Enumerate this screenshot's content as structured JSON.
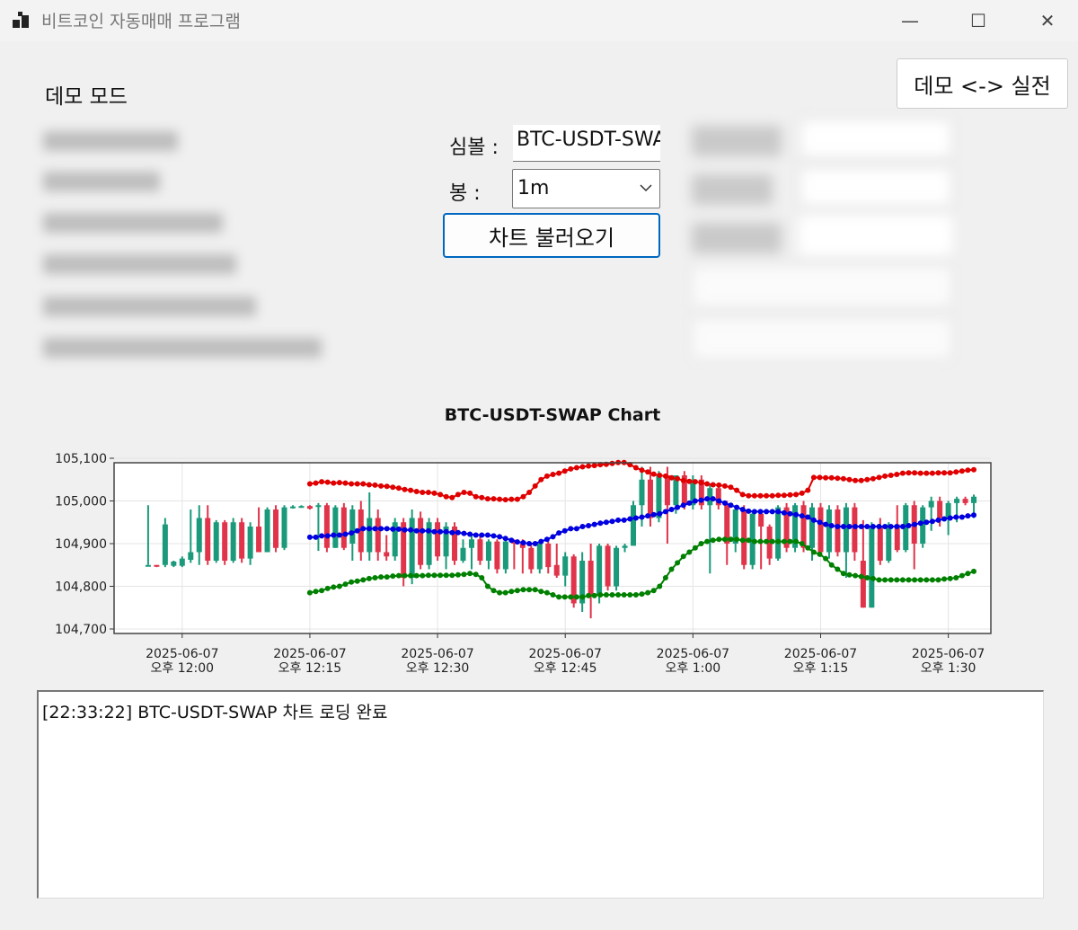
{
  "window": {
    "title": "비트코인 자동매매 프로그램",
    "minimize_glyph": "—",
    "maximize_glyph": "☐",
    "close_glyph": "✕"
  },
  "mode": {
    "label": "데모 모드",
    "toggle_label": "데모 <-> 실전"
  },
  "form": {
    "symbol_label": "심볼 :",
    "symbol_value": "BTC-USDT-SWAP",
    "interval_label": "봉 :",
    "interval_value": "1m",
    "load_button": "차트 불러오기"
  },
  "chart_data": {
    "type": "candlestick",
    "title": "BTC-USDT-SWAP Chart",
    "ylim": [
      104700,
      105100
    ],
    "y_ticks": [
      "105,100",
      "105,000",
      "104,900",
      "104,800",
      "104,700"
    ],
    "x_ticks": [
      {
        "date": "2025-06-07",
        "time": "오후 12:00"
      },
      {
        "date": "2025-06-07",
        "time": "오후 12:15"
      },
      {
        "date": "2025-06-07",
        "time": "오후 12:30"
      },
      {
        "date": "2025-06-07",
        "time": "오후 12:45"
      },
      {
        "date": "2025-06-07",
        "time": "오후 1:00"
      },
      {
        "date": "2025-06-07",
        "time": "오후 1:15"
      },
      {
        "date": "2025-06-07",
        "time": "오후 1:30"
      }
    ],
    "x_start": "2025-06-07 11:52",
    "x_end": "2025-06-07 13:35",
    "candle_times": [
      "11:56",
      "11:57",
      "11:58",
      "11:59",
      "12:00",
      "12:01",
      "12:02",
      "12:03",
      "12:04",
      "12:05",
      "12:06",
      "12:07",
      "12:08",
      "12:09",
      "12:10",
      "12:11",
      "12:12",
      "12:13",
      "12:14",
      "12:15",
      "12:16",
      "12:17",
      "12:18",
      "12:19",
      "12:20",
      "12:21",
      "12:22",
      "12:23",
      "12:24",
      "12:25",
      "12:26",
      "12:27",
      "12:28",
      "12:29",
      "12:30",
      "12:31",
      "12:32",
      "12:33",
      "12:34",
      "12:35",
      "12:36",
      "12:37",
      "12:38",
      "12:39",
      "12:40",
      "12:41",
      "12:42",
      "12:43",
      "12:44",
      "12:45",
      "12:46",
      "12:47",
      "12:48",
      "12:49",
      "12:50",
      "12:51",
      "12:52",
      "12:53",
      "12:54",
      "12:55",
      "12:56",
      "12:57",
      "12:58",
      "12:59",
      "13:00",
      "13:01",
      "13:02",
      "13:03",
      "13:04",
      "13:05",
      "13:06",
      "13:07",
      "13:08",
      "13:09",
      "13:10",
      "13:11",
      "13:12",
      "13:13",
      "13:14",
      "13:15",
      "13:16",
      "13:17",
      "13:18",
      "13:19",
      "13:20",
      "13:21",
      "13:22",
      "13:23",
      "13:24",
      "13:25",
      "13:26",
      "13:27",
      "13:28",
      "13:29",
      "13:30",
      "13:31",
      "13:32",
      "13:33"
    ],
    "candles": [
      {
        "o": 104850,
        "h": 104990,
        "l": 104850,
        "c": 104850
      },
      {
        "o": 104850,
        "h": 104850,
        "l": 104845,
        "c": 104848
      },
      {
        "o": 104850,
        "h": 104960,
        "l": 104845,
        "c": 104945
      },
      {
        "o": 104848,
        "h": 104860,
        "l": 104845,
        "c": 104858
      },
      {
        "o": 104848,
        "h": 104870,
        "l": 104845,
        "c": 104865
      },
      {
        "o": 104862,
        "h": 104980,
        "l": 104855,
        "c": 104880
      },
      {
        "o": 104880,
        "h": 104990,
        "l": 104850,
        "c": 104960
      },
      {
        "o": 104960,
        "h": 104990,
        "l": 104850,
        "c": 104860
      },
      {
        "o": 104860,
        "h": 104955,
        "l": 104855,
        "c": 104950
      },
      {
        "o": 104950,
        "h": 104955,
        "l": 104850,
        "c": 104860
      },
      {
        "o": 104860,
        "h": 104960,
        "l": 104855,
        "c": 104950
      },
      {
        "o": 104950,
        "h": 104960,
        "l": 104855,
        "c": 104865
      },
      {
        "o": 104865,
        "h": 104950,
        "l": 104850,
        "c": 104940
      },
      {
        "o": 104940,
        "h": 104985,
        "l": 104880,
        "c": 104880
      },
      {
        "o": 104880,
        "h": 104985,
        "l": 104880,
        "c": 104980
      },
      {
        "o": 104980,
        "h": 104990,
        "l": 104880,
        "c": 104890
      },
      {
        "o": 104890,
        "h": 104990,
        "l": 104885,
        "c": 104985
      },
      {
        "o": 104985,
        "h": 104990,
        "l": 104982,
        "c": 104987
      },
      {
        "o": 104987,
        "h": 104990,
        "l": 104984,
        "c": 104988
      },
      {
        "o": 104988,
        "h": 104990,
        "l": 104980,
        "c": 104982
      },
      {
        "o": 104990,
        "h": 104995,
        "l": 104883,
        "c": 104990
      },
      {
        "o": 104990,
        "h": 104995,
        "l": 104880,
        "c": 104890
      },
      {
        "o": 104890,
        "h": 104990,
        "l": 104890,
        "c": 104985
      },
      {
        "o": 104985,
        "h": 104995,
        "l": 104885,
        "c": 104890
      },
      {
        "o": 104900,
        "h": 104990,
        "l": 104860,
        "c": 104980
      },
      {
        "o": 104980,
        "h": 105000,
        "l": 104860,
        "c": 104880
      },
      {
        "o": 104880,
        "h": 105020,
        "l": 104860,
        "c": 104960
      },
      {
        "o": 104960,
        "h": 104980,
        "l": 104860,
        "c": 104880
      },
      {
        "o": 104880,
        "h": 104920,
        "l": 104860,
        "c": 104870
      },
      {
        "o": 104870,
        "h": 104960,
        "l": 104860,
        "c": 104950
      },
      {
        "o": 104950,
        "h": 104960,
        "l": 104800,
        "c": 104820
      },
      {
        "o": 104820,
        "h": 104980,
        "l": 104805,
        "c": 104960
      },
      {
        "o": 104960,
        "h": 104975,
        "l": 104840,
        "c": 104850
      },
      {
        "o": 104850,
        "h": 104960,
        "l": 104840,
        "c": 104950
      },
      {
        "o": 104950,
        "h": 104960,
        "l": 104860,
        "c": 104870
      },
      {
        "o": 104870,
        "h": 104950,
        "l": 104840,
        "c": 104940
      },
      {
        "o": 104940,
        "h": 104950,
        "l": 104850,
        "c": 104860
      },
      {
        "o": 104860,
        "h": 104910,
        "l": 104855,
        "c": 104890
      },
      {
        "o": 104890,
        "h": 104920,
        "l": 104840,
        "c": 104910
      },
      {
        "o": 104910,
        "h": 104920,
        "l": 104850,
        "c": 104860
      },
      {
        "o": 104860,
        "h": 104910,
        "l": 104840,
        "c": 104905
      },
      {
        "o": 104905,
        "h": 104910,
        "l": 104830,
        "c": 104840
      },
      {
        "o": 104840,
        "h": 104910,
        "l": 104830,
        "c": 104905
      },
      {
        "o": 104905,
        "h": 104910,
        "l": 104840,
        "c": 104900
      },
      {
        "o": 104900,
        "h": 104910,
        "l": 104830,
        "c": 104890
      },
      {
        "o": 104890,
        "h": 104900,
        "l": 104830,
        "c": 104840
      },
      {
        "o": 104840,
        "h": 104905,
        "l": 104830,
        "c": 104900
      },
      {
        "o": 104900,
        "h": 104905,
        "l": 104830,
        "c": 104845
      },
      {
        "o": 104850,
        "h": 104900,
        "l": 104820,
        "c": 104825
      },
      {
        "o": 104825,
        "h": 104880,
        "l": 104800,
        "c": 104870
      },
      {
        "o": 104870,
        "h": 104875,
        "l": 104750,
        "c": 104760
      },
      {
        "o": 104760,
        "h": 104880,
        "l": 104740,
        "c": 104860
      },
      {
        "o": 104860,
        "h": 104900,
        "l": 104725,
        "c": 104780
      },
      {
        "o": 104780,
        "h": 104900,
        "l": 104760,
        "c": 104895
      },
      {
        "o": 104895,
        "h": 104900,
        "l": 104790,
        "c": 104800
      },
      {
        "o": 104800,
        "h": 104895,
        "l": 104790,
        "c": 104890
      },
      {
        "o": 104890,
        "h": 104900,
        "l": 104880,
        "c": 104895
      },
      {
        "o": 104895,
        "h": 105000,
        "l": 104895,
        "c": 104990
      },
      {
        "o": 104990,
        "h": 105080,
        "l": 104940,
        "c": 105050
      },
      {
        "o": 105050,
        "h": 105080,
        "l": 104940,
        "c": 104960
      },
      {
        "o": 104960,
        "h": 105070,
        "l": 104950,
        "c": 105060
      },
      {
        "o": 105060,
        "h": 105080,
        "l": 104900,
        "c": 104990
      },
      {
        "o": 104990,
        "h": 105060,
        "l": 104970,
        "c": 105060
      },
      {
        "o": 105060,
        "h": 105070,
        "l": 104980,
        "c": 104990
      },
      {
        "o": 104990,
        "h": 105060,
        "l": 104980,
        "c": 105050
      },
      {
        "o": 105050,
        "h": 105060,
        "l": 104980,
        "c": 104990
      },
      {
        "o": 104990,
        "h": 105040,
        "l": 104830,
        "c": 105030
      },
      {
        "o": 105030,
        "h": 105040,
        "l": 104980,
        "c": 104990
      },
      {
        "o": 104990,
        "h": 105000,
        "l": 104850,
        "c": 104900
      },
      {
        "o": 104900,
        "h": 104990,
        "l": 104880,
        "c": 104980
      },
      {
        "o": 104980,
        "h": 104990,
        "l": 104840,
        "c": 104850
      },
      {
        "o": 104850,
        "h": 104975,
        "l": 104840,
        "c": 104970
      },
      {
        "o": 104970,
        "h": 104975,
        "l": 104840,
        "c": 104940
      },
      {
        "o": 104940,
        "h": 104945,
        "l": 104850,
        "c": 104865
      },
      {
        "o": 104865,
        "h": 104990,
        "l": 104860,
        "c": 104985
      },
      {
        "o": 104985,
        "h": 104995,
        "l": 104880,
        "c": 104890
      },
      {
        "o": 104890,
        "h": 104995,
        "l": 104880,
        "c": 104990
      },
      {
        "o": 104990,
        "h": 105000,
        "l": 104880,
        "c": 104890
      },
      {
        "o": 104890,
        "h": 104995,
        "l": 104860,
        "c": 104985
      },
      {
        "o": 104985,
        "h": 104995,
        "l": 104870,
        "c": 104880
      },
      {
        "o": 104880,
        "h": 104990,
        "l": 104865,
        "c": 104980
      },
      {
        "o": 104980,
        "h": 104990,
        "l": 104870,
        "c": 104880
      },
      {
        "o": 104880,
        "h": 104995,
        "l": 104820,
        "c": 104985
      },
      {
        "o": 104985,
        "h": 104995,
        "l": 104860,
        "c": 104880
      },
      {
        "o": 104860,
        "h": 104955,
        "l": 104750,
        "c": 104750
      },
      {
        "o": 104750,
        "h": 104950,
        "l": 104750,
        "c": 104940
      },
      {
        "o": 104940,
        "h": 104960,
        "l": 104850,
        "c": 104860
      },
      {
        "o": 104860,
        "h": 104950,
        "l": 104855,
        "c": 104945
      },
      {
        "o": 104945,
        "h": 104990,
        "l": 104880,
        "c": 104885
      },
      {
        "o": 104885,
        "h": 104995,
        "l": 104880,
        "c": 104990
      },
      {
        "o": 104990,
        "h": 105000,
        "l": 104840,
        "c": 104900
      },
      {
        "o": 104900,
        "h": 104990,
        "l": 104890,
        "c": 104985
      },
      {
        "o": 104985,
        "h": 105010,
        "l": 104930,
        "c": 105000
      },
      {
        "o": 105000,
        "h": 105010,
        "l": 104940,
        "c": 104960
      },
      {
        "o": 104960,
        "h": 105000,
        "l": 104920,
        "c": 104995
      },
      {
        "o": 104995,
        "h": 105010,
        "l": 104950,
        "c": 105005
      },
      {
        "o": 105005,
        "h": 105010,
        "l": 104990,
        "c": 104995
      },
      {
        "o": 104995,
        "h": 105015,
        "l": 104960,
        "c": 105010
      }
    ],
    "series": [
      {
        "color": "#e00000",
        "start": "12:15",
        "values": [
          105040,
          105042,
          105045,
          105044,
          105042,
          105043,
          105042,
          105040,
          105040,
          105040,
          105038,
          105037,
          105035,
          105034,
          105032,
          105030,
          105027,
          105025,
          105022,
          105020,
          105020,
          105018,
          105015,
          105010,
          105008,
          105015,
          105020,
          105018,
          105010,
          105008,
          105005,
          105005,
          105004,
          105003,
          105004,
          105004,
          105010,
          105020,
          105035,
          105050,
          105058,
          105062,
          105065,
          105070,
          105075,
          105078,
          105080,
          105082,
          105083,
          105085,
          105086,
          105088,
          105090,
          105090,
          105085,
          105078,
          105072,
          105068,
          105063,
          105060,
          105058,
          105054,
          105052,
          105048,
          105046,
          105045,
          105043,
          105040,
          105038,
          105037,
          105035,
          105032,
          105025,
          105015,
          105012,
          105012,
          105012,
          105012,
          105012,
          105013,
          105013,
          105014,
          105015,
          105018,
          105025,
          105055,
          105055,
          105054,
          105054,
          105053,
          105052,
          105050,
          105048,
          105048,
          105050,
          105052,
          105055,
          105058,
          105060,
          105062,
          105065,
          105066,
          105066,
          105065,
          105065,
          105065,
          105066,
          105066,
          105066,
          105068,
          105070,
          105072,
          105073
        ]
      },
      {
        "color": "#0000e0",
        "start": "12:15",
        "values": [
          104915,
          104915,
          104918,
          104918,
          104920,
          104920,
          104922,
          104925,
          104930,
          104935,
          104935,
          104935,
          104935,
          104935,
          104934,
          104934,
          104932,
          104932,
          104930,
          104930,
          104930,
          104928,
          104928,
          104928,
          104926,
          104926,
          104924,
          104922,
          104920,
          104920,
          104920,
          104918,
          104916,
          104912,
          104908,
          104904,
          104902,
          104900,
          104900,
          104905,
          104910,
          104916,
          104925,
          104930,
          104935,
          104935,
          104940,
          104942,
          104945,
          104948,
          104950,
          104952,
          104955,
          104955,
          104958,
          104960,
          104962,
          104965,
          104968,
          104970,
          104975,
          104980,
          104985,
          104990,
          104995,
          105000,
          105002,
          105005,
          105005,
          105000,
          104995,
          104990,
          104985,
          104980,
          104976,
          104975,
          104975,
          104975,
          104975,
          104975,
          104972,
          104970,
          104968,
          104965,
          104962,
          104955,
          104950,
          104945,
          104942,
          104940,
          104940,
          104940,
          104940,
          104940,
          104940,
          104940,
          104940,
          104940,
          104940,
          104940,
          104940,
          104942,
          104945,
          104948,
          104950,
          104952,
          104955,
          104958,
          104960,
          104962,
          104962,
          104965,
          104967
        ]
      },
      {
        "color": "#008000",
        "start": "12:15",
        "values": [
          104785,
          104788,
          104790,
          104795,
          104798,
          104800,
          104805,
          104810,
          104812,
          104815,
          104818,
          104820,
          104822,
          104822,
          104824,
          104825,
          104825,
          104825,
          104825,
          104825,
          104826,
          104826,
          104826,
          104826,
          104826,
          104827,
          104828,
          104830,
          104828,
          104820,
          104800,
          104790,
          104785,
          104785,
          104788,
          104790,
          104792,
          104792,
          104792,
          104788,
          104785,
          104780,
          104775,
          104775,
          104775,
          104775,
          104775,
          104778,
          104778,
          104780,
          104780,
          104780,
          104780,
          104780,
          104780,
          104780,
          104782,
          104785,
          104790,
          104800,
          104820,
          104840,
          104855,
          104870,
          104880,
          104890,
          104900,
          104905,
          104908,
          104910,
          104910,
          104910,
          104910,
          104908,
          104908,
          104905,
          104905,
          104905,
          104905,
          104905,
          104905,
          104905,
          104905,
          104900,
          104890,
          104880,
          104875,
          104865,
          104850,
          104840,
          104830,
          104827,
          104825,
          104823,
          104820,
          104818,
          104815,
          104815,
          104815,
          104815,
          104815,
          104815,
          104815,
          104815,
          104815,
          104815,
          104815,
          104817,
          104818,
          104820,
          104825,
          104830,
          104835
        ]
      }
    ]
  },
  "log": {
    "lines": [
      "[22:33:22] BTC-USDT-SWAP 차트 로딩 완료"
    ]
  }
}
